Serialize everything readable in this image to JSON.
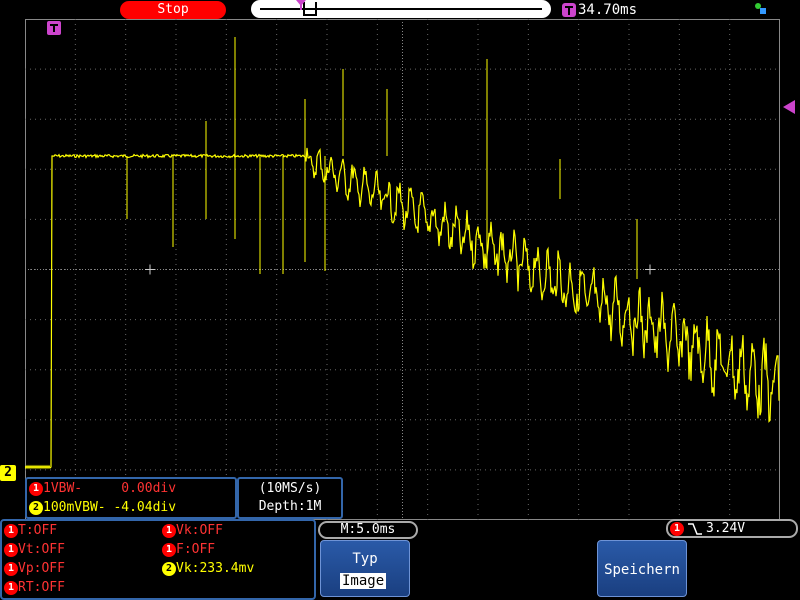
{
  "header": {
    "status": "Stop",
    "trigger_time": "34.70ms"
  },
  "channels": {
    "ch1": {
      "label": "1",
      "text": "1VBW-     0.00div"
    },
    "ch2": {
      "label": "2",
      "text": "100mVBW- -4.04div"
    }
  },
  "acquisition": {
    "rate": "(10MS/s)",
    "depth": "Depth:1M"
  },
  "measurements": {
    "t": "T:OFF",
    "vt": "Vt:OFF",
    "vp": "Vp:OFF",
    "rt": "RT:OFF",
    "vk": "Vk:OFF",
    "f": "F:OFF",
    "vk2": "Vk:233.4mv"
  },
  "timebase": "M:5.0ms",
  "trigger": {
    "source": "1",
    "level": "3.24V"
  },
  "softkeys": {
    "typ_label": "Typ",
    "typ_value": "Image",
    "save_label": "Speichern"
  },
  "colors": {
    "ch1": "#ff0000",
    "ch2": "#ffff00",
    "trigger": "#cc44cc",
    "panel_border": "#3366aa",
    "softkey": "#2a5aa8"
  }
}
